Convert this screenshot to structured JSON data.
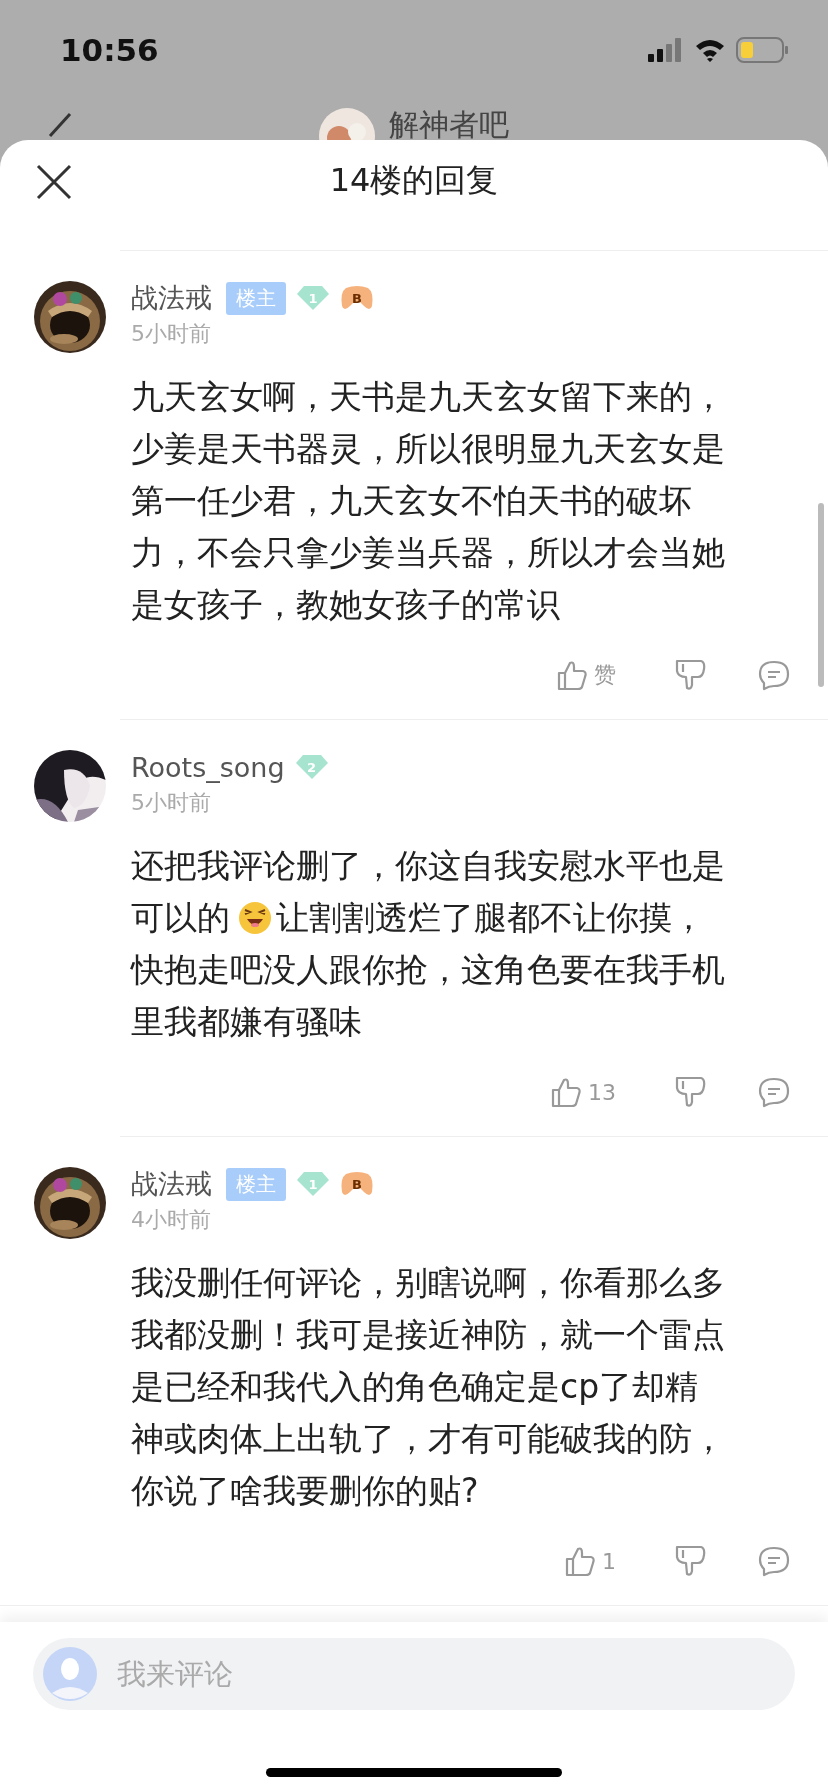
{
  "status_bar": {
    "time": "10:56"
  },
  "background_header": {
    "title": "解神者吧"
  },
  "sheet": {
    "title": "14楼的回复"
  },
  "comments": [
    {
      "name": "战法戒",
      "owner_tag": "楼主",
      "rank": "1",
      "game_badge": "B",
      "time": "5小时前",
      "lines": [
        [
          "九天玄女啊，天书是九天玄女留下来的，"
        ],
        [
          "少姜是天书器灵，所以很明显九天玄女是"
        ],
        [
          "第一任少君，九天玄女不怕天书的破坏"
        ],
        [
          "力，不会只拿少姜当兵器，所以才会当她"
        ],
        [
          "是女孩子，教她女孩子的常识"
        ]
      ],
      "likes": "赞"
    },
    {
      "name": "Roots_song",
      "rank": "2",
      "time": "5小时前",
      "lines": [
        [
          "还把我评论删了，你这自我安慰水平也是"
        ],
        [
          "可以的",
          "让割割透烂了腿都不让你摸，"
        ],
        [
          "快抱走吧没人跟你抢，这角色要在我手机"
        ],
        [
          "里我都嫌有骚味"
        ]
      ],
      "likes": "13"
    },
    {
      "name": "战法戒",
      "owner_tag": "楼主",
      "rank": "1",
      "game_badge": "B",
      "time": "4小时前",
      "lines": [
        [
          "我没删任何评论，别瞎说啊，你看那么多"
        ],
        [
          "我都没删！我可是接近神防，就一个雷点"
        ],
        [
          "是已经和我代入的角色确定是cp了却精"
        ],
        [
          "神或肉体上出轨了，才有可能破我的防，"
        ],
        [
          "你说了啥我要删你的贴?"
        ]
      ],
      "likes": "1"
    }
  ],
  "comment_input": {
    "placeholder": "我来评论"
  }
}
